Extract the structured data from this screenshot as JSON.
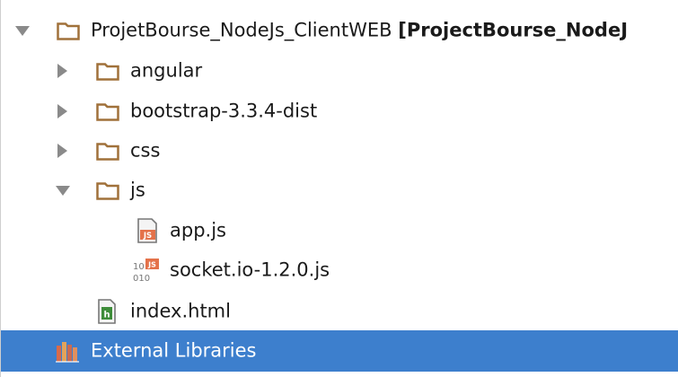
{
  "project_tree": {
    "root": {
      "name": "ProjetBourse_NodeJs_ClientWEB",
      "suffix": "[ProjectBourse_NodeJ",
      "expanded": true,
      "icon": "folder-icon"
    },
    "items": [
      {
        "name": "angular",
        "icon": "folder-icon",
        "expanded": false
      },
      {
        "name": "bootstrap-3.3.4-dist",
        "icon": "folder-icon",
        "expanded": false
      },
      {
        "name": "css",
        "icon": "folder-icon",
        "expanded": false
      },
      {
        "name": "js",
        "icon": "folder-icon",
        "expanded": true
      },
      {
        "name": "app.js",
        "icon": "javascript-file-icon"
      },
      {
        "name": "socket.io-1.2.0.js",
        "icon": "minified-javascript-file-icon"
      },
      {
        "name": "index.html",
        "icon": "html-file-icon"
      }
    ],
    "external_libraries": {
      "name": "External Libraries",
      "icon": "library-icon",
      "selected": true
    }
  },
  "colors": {
    "selection": "#3d7fcd",
    "folder_outline": "#a0713a",
    "js_badge": "#e4724a",
    "html_badge": "#3e8d3a",
    "arrow": "#8a8a8a"
  }
}
